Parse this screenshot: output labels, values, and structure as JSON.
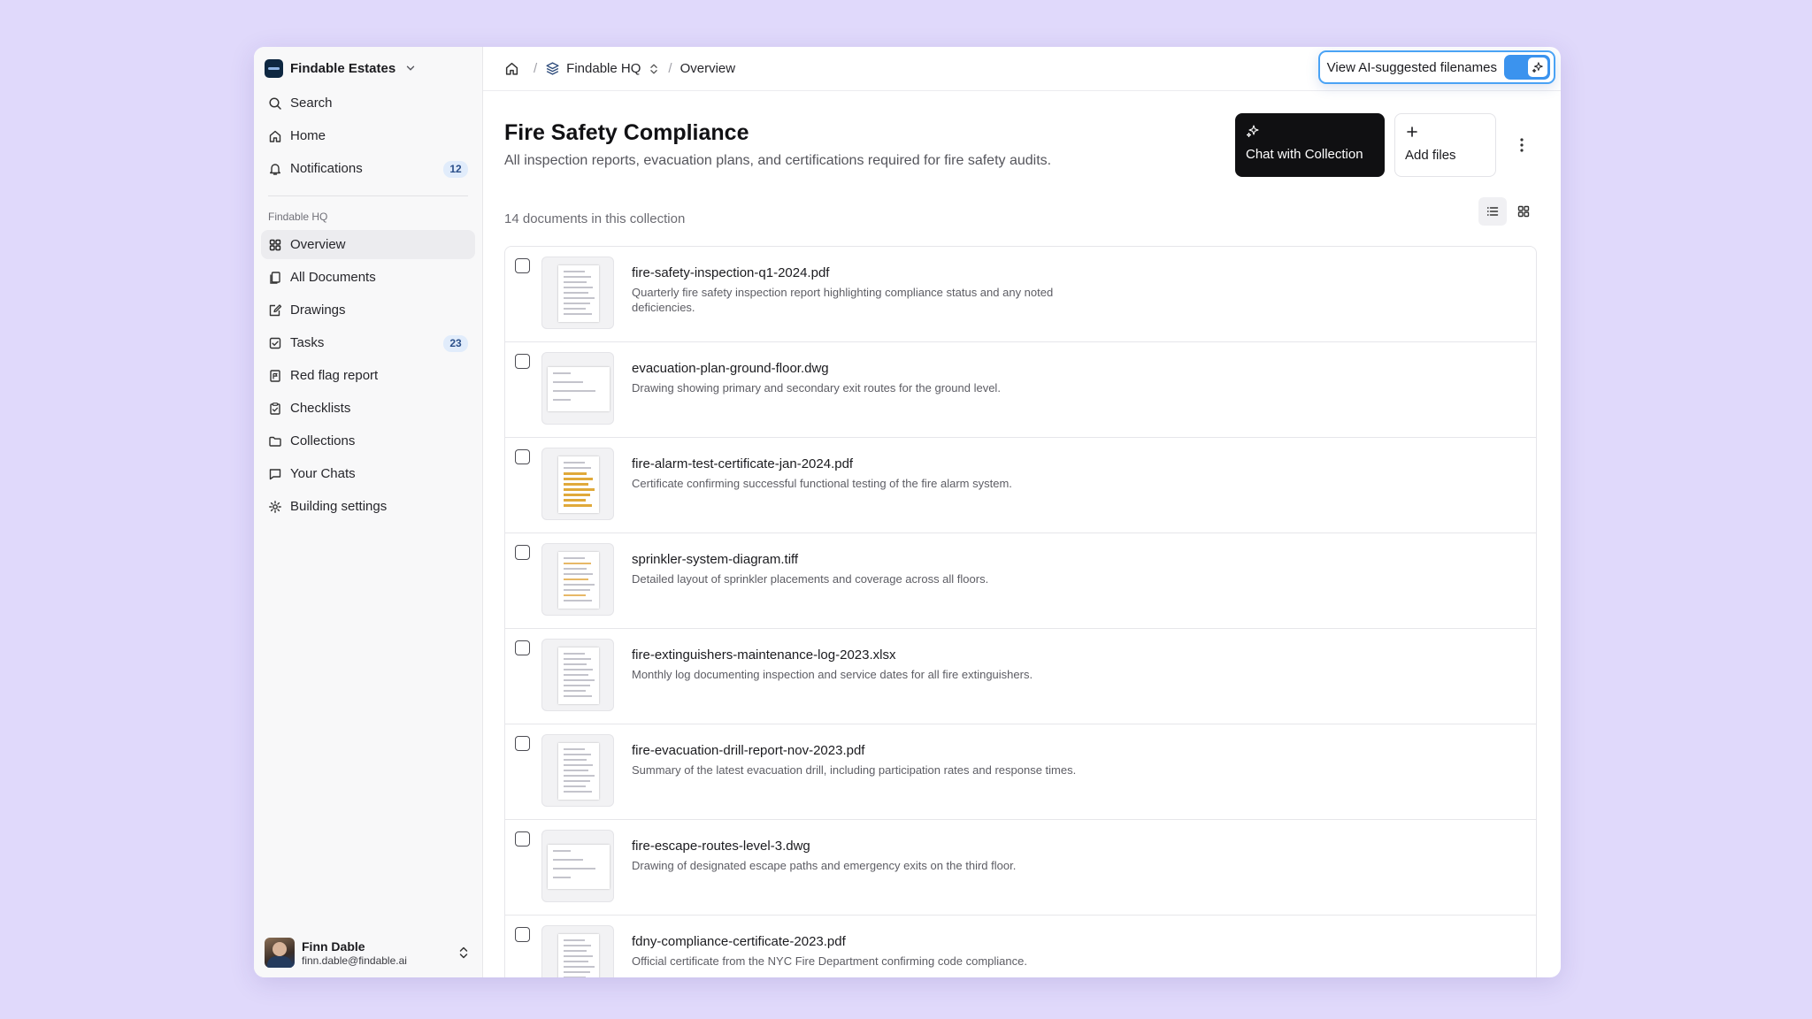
{
  "workspace": {
    "name": "Findable Estates"
  },
  "nav_top": [
    {
      "label": "Search",
      "icon": "search-icon"
    },
    {
      "label": "Home",
      "icon": "home-icon"
    },
    {
      "label": "Notifications",
      "icon": "bell-icon",
      "badge": "12"
    }
  ],
  "section_label": "Findable HQ",
  "nav_main": [
    {
      "label": "Overview",
      "icon": "grid-icon",
      "active": true
    },
    {
      "label": "All Documents",
      "icon": "documents-icon"
    },
    {
      "label": "Drawings",
      "icon": "drawing-icon"
    },
    {
      "label": "Tasks",
      "icon": "checkbox-icon",
      "badge": "23"
    },
    {
      "label": "Red flag report",
      "icon": "flag-report-icon"
    },
    {
      "label": "Checklists",
      "icon": "clipboard-icon"
    },
    {
      "label": "Collections",
      "icon": "folder-icon"
    },
    {
      "label": "Your Chats",
      "icon": "chat-icon"
    },
    {
      "label": "Building settings",
      "icon": "gear-icon"
    }
  ],
  "user": {
    "name": "Finn Dable",
    "email": "finn.dable@findable.ai"
  },
  "breadcrumb": {
    "sep": "/",
    "building": "Findable HQ",
    "page": "Overview"
  },
  "ai_toggle": {
    "label": "View AI-suggested filenames",
    "on": true
  },
  "header": {
    "title": "Fire Safety Compliance",
    "subtitle": "All inspection reports, evacuation plans, and certifications required for fire safety audits.",
    "chat_label": "Chat with Collection",
    "add_label": "Add files",
    "doc_count": "14 documents in this collection"
  },
  "documents": [
    {
      "name": "fire-safety-inspection-q1-2024.pdf",
      "desc": "Quarterly fire safety inspection report highlighting compliance status and any noted deficiencies.",
      "thumb": "doc"
    },
    {
      "name": "evacuation-plan-ground-floor.dwg",
      "desc": "Drawing showing primary and secondary exit routes for the ground level.",
      "thumb": "drawing"
    },
    {
      "name": "fire-alarm-test-certificate-jan-2024.pdf",
      "desc": "Certificate confirming successful functional testing of the fire alarm system.",
      "thumb": "certificate"
    },
    {
      "name": "sprinkler-system-diagram.tiff",
      "desc": "Detailed layout of sprinkler placements and coverage across all floors.",
      "thumb": "diagram"
    },
    {
      "name": "fire-extinguishers-maintenance-log-2023.xlsx",
      "desc": "Monthly log documenting inspection and service dates for all fire extinguishers.",
      "thumb": "doc"
    },
    {
      "name": "fire-evacuation-drill-report-nov-2023.pdf",
      "desc": "Summary of the latest evacuation drill, including participation rates and response times.",
      "thumb": "doc"
    },
    {
      "name": "fire-escape-routes-level-3.dwg",
      "desc": "Drawing of designated escape paths and emergency exits on the third floor.",
      "thumb": "drawing"
    },
    {
      "name": "fdny-compliance-certificate-2023.pdf",
      "desc": "Official certificate from the NYC Fire Department confirming code compliance.",
      "thumb": "doc"
    }
  ],
  "colors": {
    "accent": "#3b93ee",
    "background": "#e0d9fb",
    "chat_button": "#101012",
    "badge_bg": "#e1ecfb"
  }
}
